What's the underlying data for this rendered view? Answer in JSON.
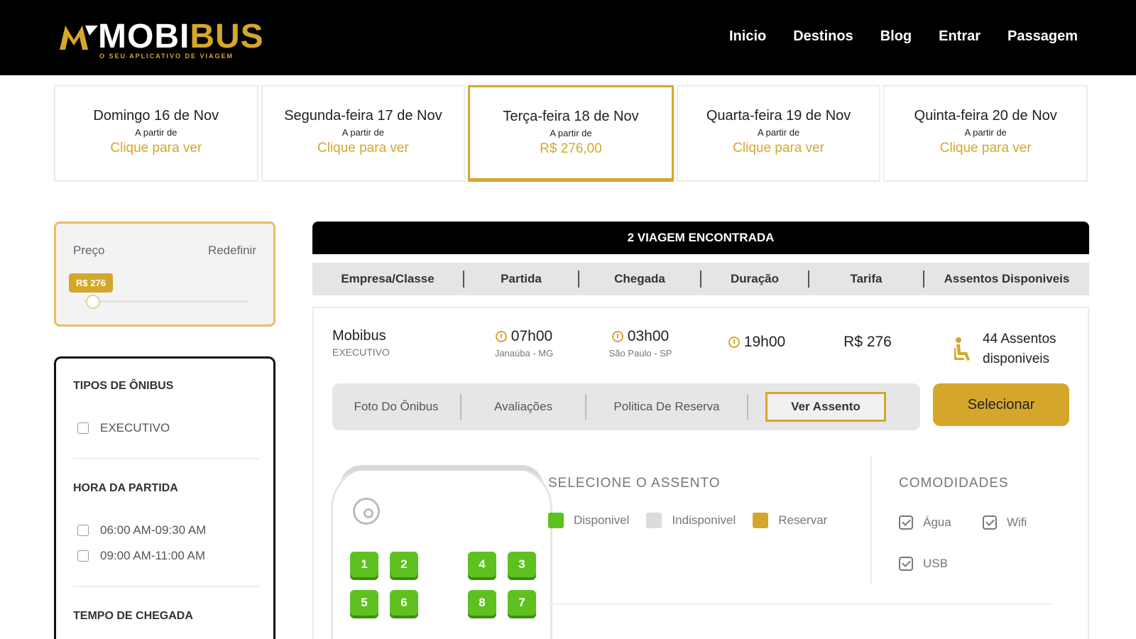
{
  "brand": {
    "name_white": "MOBI",
    "name_gold": "BUS",
    "tagline": "O SEU APLICATIVO DE VIAGEM",
    "gold": "#d4a72c"
  },
  "nav": [
    "Inicio",
    "Destinos",
    "Blog",
    "Entrar",
    "Passagem"
  ],
  "dates": [
    {
      "day": "Domingo 16 de Nov",
      "from": "A partir de",
      "price": "Clique para ver",
      "active": false
    },
    {
      "day": "Segunda-feira 17 de Nov",
      "from": "A partir de",
      "price": "Clique para ver",
      "active": false
    },
    {
      "day": "Terça-feira 18 de Nov",
      "from": "A partir de",
      "price": "R$ 276,00",
      "active": true
    },
    {
      "day": "Quarta-feira 19 de Nov",
      "from": "A partir de",
      "price": "Clique para ver",
      "active": false
    },
    {
      "day": "Quinta-feira 20 de Nov",
      "from": "A partir de",
      "price": "Clique para ver",
      "active": false
    }
  ],
  "price_filter": {
    "label": "Preço",
    "reset": "Redefinir",
    "value": "R$ 276"
  },
  "filters": {
    "bus_types_title": "TIPOS DE ÔNIBUS",
    "bus_types": [
      "EXECUTIVO"
    ],
    "departure_title": "HORA DA PARTIDA",
    "departure_times": [
      "06:00 AM-09:30 AM",
      "09:00 AM-11:00 AM"
    ],
    "arrival_title": "TEMPO DE CHEGADA"
  },
  "results": {
    "title": "2 VIAGEM ENCONTRADA",
    "columns": [
      "Empresa/Classe",
      "Partida",
      "Chegada",
      "Duração",
      "Tarifa",
      "Assentos Disponiveis"
    ]
  },
  "trip": {
    "company": "Mobibus",
    "class": "EXECUTIVO",
    "departure_time": "07h00",
    "departure_place": "Janaúba - MG",
    "arrival_time": "03h00",
    "arrival_place": "São Paulo - SP",
    "duration": "19h00",
    "fare": "R$ 276",
    "seats_line1": "44 Assentos",
    "seats_line2": "disponiveis",
    "tabs": [
      "Foto Do Ônibus",
      "Avaliações",
      "Politica De Reserva",
      "Ver Assento"
    ],
    "select_label": "Selecionar"
  },
  "seat_map": {
    "title": "SELECIONE O ASSENTO",
    "legend": [
      {
        "label": "Disponivel",
        "color": "#5fc11f"
      },
      {
        "label": "Indisponivel",
        "color": "#dcdcdc"
      },
      {
        "label": "Reservar",
        "color": "#d4a72c"
      }
    ],
    "rows": [
      [
        "1",
        "2",
        "4",
        "3"
      ],
      [
        "5",
        "6",
        "8",
        "7"
      ]
    ]
  },
  "amenities": {
    "title": "COMODIDADES",
    "items": [
      "Água",
      "Wifi",
      "USB"
    ]
  }
}
